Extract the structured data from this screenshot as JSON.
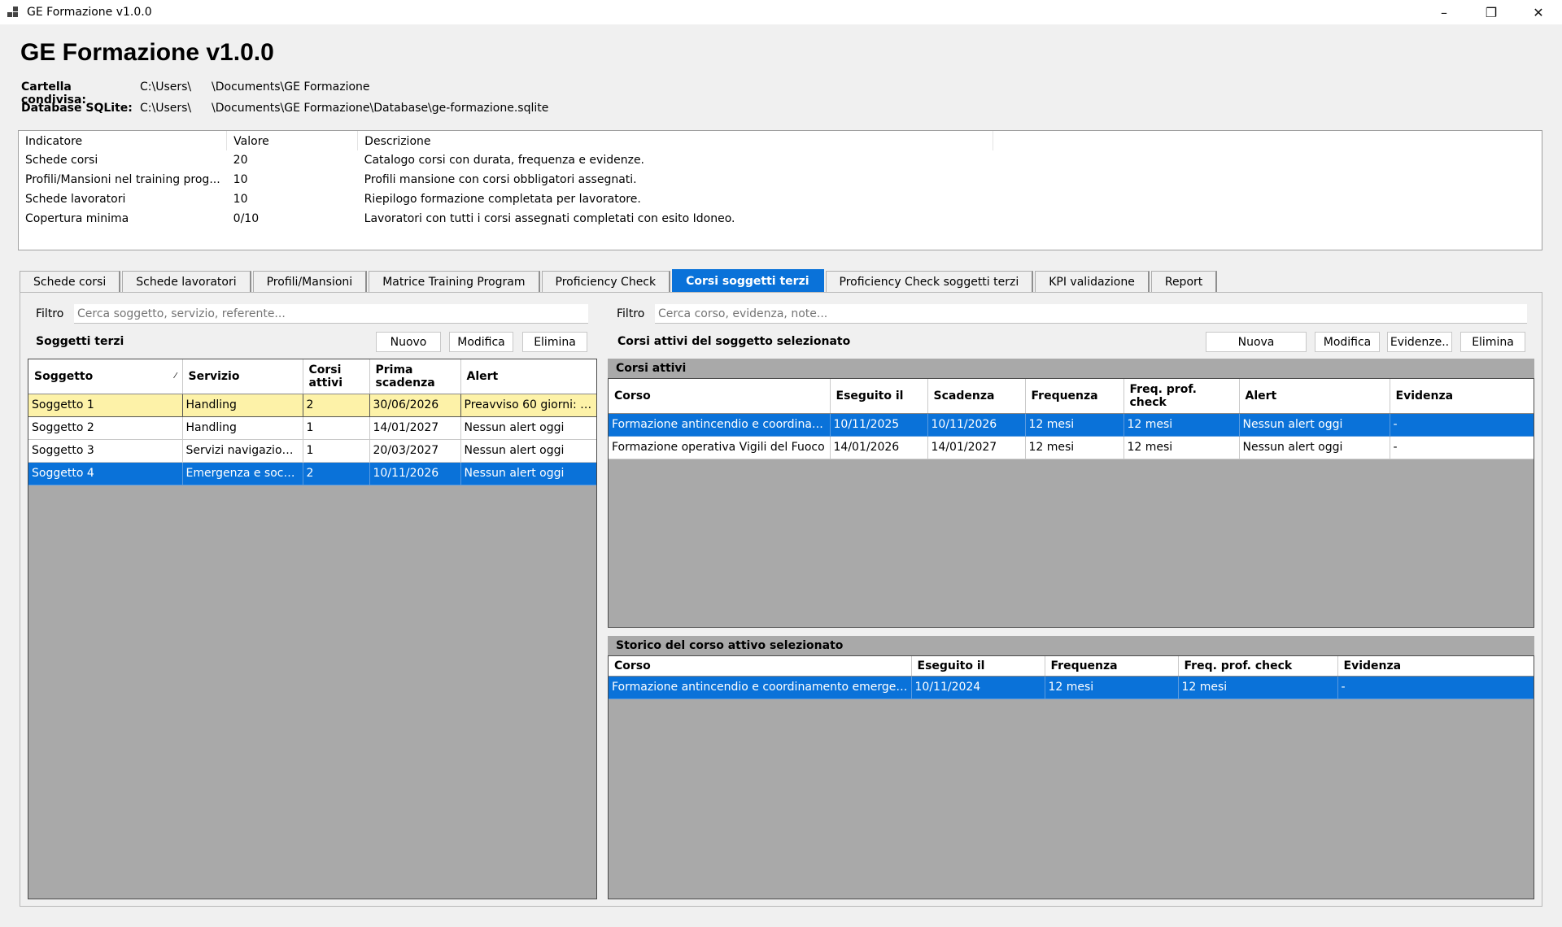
{
  "window": {
    "title": "GE Formazione v1.0.0",
    "minimize": "–",
    "restore": "❐",
    "close": "✕"
  },
  "header": {
    "title": "GE Formazione v1.0.0",
    "shared_folder_label": "Cartella condivisa:",
    "shared_folder_p1": "C:\\Users\\",
    "shared_folder_p2": "\\Documents\\GE Formazione",
    "db_label": "Database SQLite:",
    "db_p1": "C:\\Users\\",
    "db_p2": "\\Documents\\GE Formazione\\Database\\ge-formazione.sqlite"
  },
  "kpi": {
    "columns": [
      "Indicatore",
      "Valore",
      "Descrizione"
    ],
    "rows": [
      [
        "Schede corsi",
        "20",
        "Catalogo corsi con durata, frequenza e evidenze."
      ],
      [
        "Profili/Mansioni nel training prog...",
        "10",
        "Profili mansione con corsi obbligatori assegnati."
      ],
      [
        "Schede lavoratori",
        "10",
        "Riepilogo formazione completata per lavoratore."
      ],
      [
        "Copertura minima",
        "0/10",
        "Lavoratori con tutti i corsi assegnati completati con esito Idoneo."
      ]
    ]
  },
  "tabs": [
    "Schede corsi",
    "Schede lavoratori",
    "Profili/Mansioni",
    "Matrice Training Program",
    "Proficiency Check",
    "Corsi soggetti terzi",
    "Proficiency Check soggetti terzi",
    "KPI validazione",
    "Report"
  ],
  "left": {
    "filter_label": "Filtro",
    "filter_placeholder": "Cerca soggetto, servizio, referente...",
    "title": "Soggetti terzi",
    "btn_new": "Nuovo",
    "btn_edit": "Modifica",
    "btn_delete": "Elimina",
    "columns": [
      "Soggetto",
      "Servizio",
      "Corsi attivi",
      "Prima scadenza",
      "Alert"
    ],
    "rows": [
      [
        "Soggetto 1",
        "Handling",
        "2",
        "30/06/2026",
        "Preavviso 60 giorni: m..."
      ],
      [
        "Soggetto 2",
        "Handling",
        "1",
        "14/01/2027",
        "Nessun alert oggi"
      ],
      [
        "Soggetto 3",
        "Servizi navigazione...",
        "1",
        "20/03/2027",
        "Nessun alert oggi"
      ],
      [
        "Soggetto 4",
        "Emergenza e socco...",
        "2",
        "10/11/2026",
        "Nessun alert oggi"
      ]
    ]
  },
  "right": {
    "filter_label": "Filtro",
    "filter_placeholder": "Cerca corso, evidenza, note...",
    "title": "Corsi attivi del soggetto selezionato",
    "btn_new": "Nuova",
    "btn_edit": "Modifica",
    "btn_evidence": "Evidenze..",
    "btn_delete": "Elimina",
    "active_caption": "Corsi attivi",
    "active_columns": [
      "Corso",
      "Eseguito il",
      "Scadenza",
      "Frequenza",
      "Freq. prof. check",
      "Alert",
      "Evidenza"
    ],
    "active_rows": [
      [
        "Formazione antincendio e coordinam...",
        "10/11/2025",
        "10/11/2026",
        "12 mesi",
        "12 mesi",
        "Nessun alert oggi",
        "-"
      ],
      [
        "Formazione operativa Vigili del Fuoco",
        "14/01/2026",
        "14/01/2027",
        "12 mesi",
        "12 mesi",
        "Nessun alert oggi",
        "-"
      ]
    ],
    "history_caption": "Storico del corso attivo selezionato",
    "history_columns": [
      "Corso",
      "Eseguito il",
      "Frequenza",
      "Freq. prof. check",
      "Evidenza"
    ],
    "history_rows": [
      [
        "Formazione antincendio e coordinamento emergenze",
        "10/11/2024",
        "12 mesi",
        "12 mesi",
        "-"
      ]
    ]
  },
  "colors": {
    "accent": "#0a72d9",
    "warning_row": "#fdf2a8",
    "grid_bg": "#a9a9a9"
  }
}
